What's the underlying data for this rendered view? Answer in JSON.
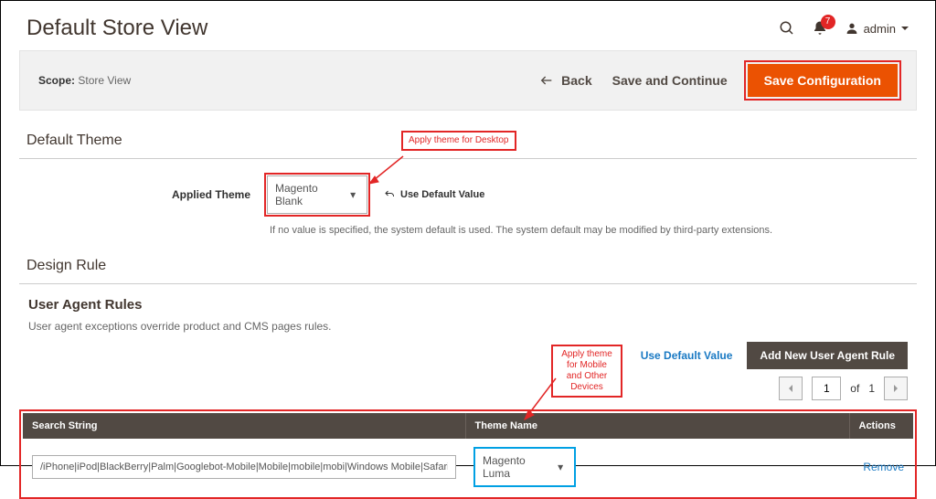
{
  "header": {
    "page_title": "Default Store View",
    "notification_count": "7",
    "admin_user": "admin"
  },
  "scope_bar": {
    "scope_label": "Scope:",
    "scope_value": "Store View",
    "back_label": "Back",
    "save_continue_label": "Save and Continue",
    "save_config_label": "Save Configuration"
  },
  "default_theme": {
    "section_title": "Default Theme",
    "field_label": "Applied Theme",
    "select_value": "Magento Blank",
    "reset_label": "Use Default Value",
    "help_note": "If no value is specified, the system default is used. The system default may be modified by third-party extensions."
  },
  "design_rule": {
    "section_title": "Design Rule",
    "sub_title": "User Agent Rules",
    "sub_desc": "User agent exceptions override product and CMS pages rules.",
    "use_default_link": "Use Default Value",
    "add_rule_label": "Add New User Agent Rule",
    "pager": {
      "page": "1",
      "of_label": "of",
      "total": "1"
    },
    "table": {
      "col_search": "Search String",
      "col_theme": "Theme Name",
      "col_actions": "Actions",
      "rows": [
        {
          "search_string": "/iPhone|iPod|BlackBerry|Palm|Googlebot-Mobile|Mobile|mobile|mobi|Windows Mobile|Safari",
          "theme_value": "Magento Luma",
          "remove_label": "Remove"
        }
      ]
    }
  },
  "annotations": {
    "desktop_callout": "Apply theme for Desktop",
    "mobile_callout": "Apply theme for Mobile and Other Devices"
  }
}
